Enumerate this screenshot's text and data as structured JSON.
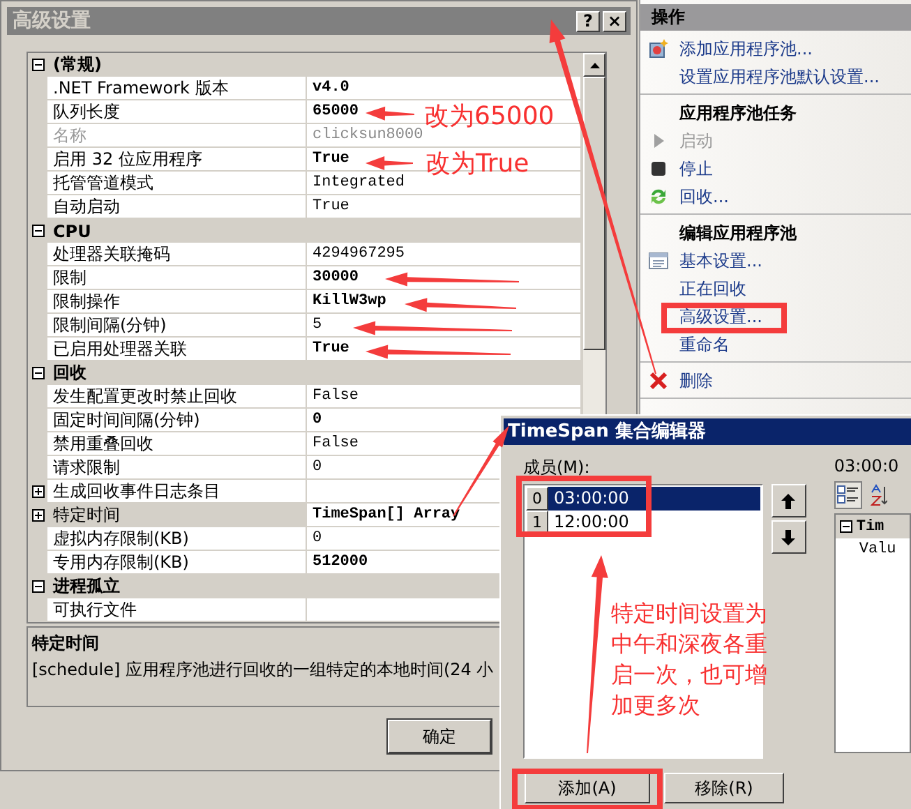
{
  "settings_window": {
    "title": "高级设置",
    "help_button": "?",
    "close_button": "×",
    "categories": [
      {
        "name": "(常规)",
        "expanded": true,
        "properties": [
          {
            "name": ".NET Framework 版本",
            "value": "v4.0",
            "kind": "plain",
            "modified": true,
            "disabled": false,
            "selected": false
          },
          {
            "name": "队列长度",
            "value": "65000",
            "kind": "plain",
            "modified": true,
            "disabled": false,
            "selected": false
          },
          {
            "name": "名称",
            "value": "clicksun8000",
            "kind": "plain",
            "modified": false,
            "disabled": true,
            "selected": false
          },
          {
            "name": "启用 32 位应用程序",
            "value": "True",
            "kind": "plain",
            "modified": true,
            "disabled": false,
            "selected": false
          },
          {
            "name": "托管管道模式",
            "value": "Integrated",
            "kind": "plain",
            "modified": false,
            "disabled": false,
            "selected": false
          },
          {
            "name": "自动启动",
            "value": "True",
            "kind": "plain",
            "modified": false,
            "disabled": false,
            "selected": false
          }
        ]
      },
      {
        "name": "CPU",
        "expanded": true,
        "properties": [
          {
            "name": "处理器关联掩码",
            "value": "4294967295",
            "kind": "plain",
            "modified": false,
            "disabled": false,
            "selected": false
          },
          {
            "name": "限制",
            "value": "30000",
            "kind": "plain",
            "modified": true,
            "disabled": false,
            "selected": false
          },
          {
            "name": "限制操作",
            "value": "KillW3wp",
            "kind": "plain",
            "modified": true,
            "disabled": false,
            "selected": false
          },
          {
            "name": "限制间隔(分钟)",
            "value": "5",
            "kind": "plain",
            "modified": false,
            "disabled": false,
            "selected": false
          },
          {
            "name": "已启用处理器关联",
            "value": "True",
            "kind": "plain",
            "modified": true,
            "disabled": false,
            "selected": false
          }
        ]
      },
      {
        "name": "回收",
        "expanded": true,
        "properties": [
          {
            "name": "发生配置更改时禁止回收",
            "value": "False",
            "kind": "plain",
            "modified": false,
            "disabled": false,
            "selected": false
          },
          {
            "name": "固定时间间隔(分钟)",
            "value": "0",
            "kind": "plain",
            "modified": true,
            "disabled": false,
            "selected": false
          },
          {
            "name": "禁用重叠回收",
            "value": "False",
            "kind": "plain",
            "modified": false,
            "disabled": false,
            "selected": false
          },
          {
            "name": "请求限制",
            "value": "0",
            "kind": "plain",
            "modified": false,
            "disabled": false,
            "selected": false
          },
          {
            "name": "生成回收事件日志条目",
            "kind": "expandable",
            "modified": false,
            "disabled": false,
            "selected": false
          },
          {
            "name": "特定时间",
            "value": "TimeSpan[] Array",
            "kind": "expandable",
            "modified": true,
            "disabled": false,
            "selected": true
          },
          {
            "name": "虚拟内存限制(KB)",
            "value": "0",
            "kind": "plain",
            "modified": false,
            "disabled": false,
            "selected": false
          },
          {
            "name": "专用内存限制(KB)",
            "value": "512000",
            "kind": "plain",
            "modified": true,
            "disabled": false,
            "selected": false
          }
        ]
      },
      {
        "name": "进程孤立",
        "expanded": true,
        "properties": [
          {
            "name": "可执行文件",
            "kind": "plain",
            "modified": false,
            "disabled": false,
            "selected": false
          }
        ]
      }
    ],
    "description": {
      "title": "特定时间",
      "text": "[schedule] 应用程序池进行回收的一组特定的本地时间(24 小"
    },
    "ok_button": "确定"
  },
  "actions_panel": {
    "title": "操作",
    "sections": [
      {
        "items": [
          {
            "label": "添加应用程序池...",
            "disabled": false
          },
          {
            "label": "设置应用程序池默认设置...",
            "disabled": false
          }
        ]
      },
      {
        "heading": "应用程序池任务",
        "items": [
          {
            "label": "启动",
            "disabled": true
          },
          {
            "label": "停止",
            "disabled": false
          },
          {
            "label": "回收...",
            "disabled": false
          }
        ]
      },
      {
        "heading": "编辑应用程序池",
        "items": [
          {
            "label": "基本设置...",
            "disabled": false
          },
          {
            "label": "正在回收",
            "disabled": false
          },
          {
            "label": "高级设置...",
            "disabled": false
          },
          {
            "label": "重命名",
            "disabled": false
          }
        ]
      },
      {
        "items": [
          {
            "label": "删除",
            "disabled": false
          }
        ]
      }
    ]
  },
  "collection_editor": {
    "title": "TimeSpan 集合编辑器",
    "members_label": "成员(M):",
    "members": [
      {
        "index": "0",
        "value": "03:00:00",
        "selected": true
      },
      {
        "index": "1",
        "value": "12:00:00",
        "selected": false
      }
    ],
    "selected_title": "03:00:0",
    "grid_category": "Tim",
    "grid_property": "Valu",
    "add_button": "添加(A)",
    "remove_button": "移除(R)"
  },
  "annotations": {
    "notes": [
      "改为65000",
      "改为True",
      "特定时间设置为中午和深夜各重启一次，也可增加更多次"
    ]
  }
}
